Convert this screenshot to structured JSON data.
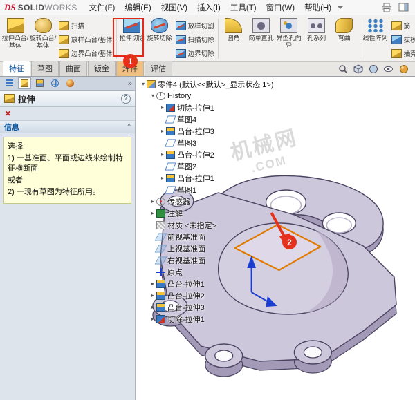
{
  "menubar": {
    "logo": {
      "ds": "DS",
      "text_bold": "SOLID",
      "text_light": "WORKS"
    },
    "menus": [
      {
        "label": "文件(F)"
      },
      {
        "label": "编辑(E)"
      },
      {
        "label": "视图(V)"
      },
      {
        "label": "插入(I)"
      },
      {
        "label": "工具(T)"
      },
      {
        "label": "窗口(W)"
      },
      {
        "label": "帮助(H)"
      }
    ],
    "right_icons": [
      "printer-icon",
      "toggle-panel-icon"
    ]
  },
  "ribbon": {
    "big": [
      {
        "label": "拉伸凸台/基体",
        "icon": "extrude-boss"
      },
      {
        "label": "旋转凸台/基体",
        "icon": "revolve-boss"
      },
      {
        "label": "拉伸切除",
        "icon": "extrude-cut"
      },
      {
        "label": "旋转切除",
        "icon": "revolve-cut"
      },
      {
        "label": "圆角",
        "icon": "fillet"
      },
      {
        "label": "简单直孔",
        "icon": "simple-hole"
      },
      {
        "label": "异型孔向导",
        "icon": "hole-wizard"
      },
      {
        "label": "孔系列",
        "icon": "hole-series"
      },
      {
        "label": "弯曲",
        "icon": "flex"
      },
      {
        "label": "线性阵列",
        "icon": "linear-pattern"
      }
    ],
    "stack1": [
      {
        "label": "扫描",
        "icon": "sweep"
      },
      {
        "label": "放样凸台/基体",
        "icon": "loft"
      },
      {
        "label": "边界凸台/基体",
        "icon": "boundary"
      }
    ],
    "stack2": [
      {
        "label": "放样切割",
        "icon": "loft-cut"
      },
      {
        "label": "扫描切除",
        "icon": "sweep-cut"
      },
      {
        "label": "边界切除",
        "icon": "boundary-cut"
      }
    ],
    "stack3": [
      {
        "label": "筋",
        "icon": "rib"
      },
      {
        "label": "拔模",
        "icon": "draft"
      },
      {
        "label": "抽壳",
        "icon": "shell"
      }
    ],
    "annotation_badge": "1"
  },
  "tabs": {
    "items": [
      {
        "label": "特征",
        "state": "active"
      },
      {
        "label": "草图",
        "state": "normal"
      },
      {
        "label": "曲面",
        "state": "normal"
      },
      {
        "label": "钣金",
        "state": "normal"
      },
      {
        "label": "焊件",
        "state": "highlight"
      },
      {
        "label": "评估",
        "state": "normal"
      }
    ]
  },
  "headsup_icons": [
    "zoom-fit-icon",
    "view-orientation-icon",
    "display-style-icon",
    "hide-show-icon",
    "appearance-icon"
  ],
  "panel": {
    "tab_icons": [
      "featuremanager-tab",
      "propertymanager-tab",
      "configurationmanager-tab",
      "dimxpert-tab",
      "displaymanager-tab"
    ],
    "flyout_glyph": "»",
    "title": "拉伸",
    "help_glyph": "?",
    "close_glyph": "×",
    "info": {
      "header": "信息",
      "collapse_glyph": "^"
    },
    "message_lines": [
      "选择:",
      "1) 一基准面、平面或边线来绘制特征横断面",
      "或者",
      "2) 一现有草图为特征所用。"
    ]
  },
  "tree": {
    "items": [
      {
        "label": "零件4 (默认<<默认>_显示状态 1>)",
        "lv": "lv0",
        "arrow": "▾",
        "icon": "part"
      },
      {
        "label": "History",
        "lv": "lv1",
        "arrow": "▾",
        "icon": "hist"
      },
      {
        "label": "切除-拉伸1",
        "lv": "lv2",
        "arrow": "▸",
        "icon": "cut"
      },
      {
        "label": "草图4",
        "lv": "lv2",
        "arrow": "",
        "icon": "sketch"
      },
      {
        "label": "凸台-拉伸3",
        "lv": "lv2",
        "arrow": "▸",
        "icon": "boss"
      },
      {
        "label": "草图3",
        "lv": "lv2",
        "arrow": "",
        "icon": "sketch"
      },
      {
        "label": "凸台-拉伸2",
        "lv": "lv2",
        "arrow": "▸",
        "icon": "boss"
      },
      {
        "label": "草图2",
        "lv": "lv2",
        "arrow": "",
        "icon": "sketch"
      },
      {
        "label": "凸台-拉伸1",
        "lv": "lv2",
        "arrow": "▸",
        "icon": "boss"
      },
      {
        "label": "草图1",
        "lv": "lv2",
        "arrow": "",
        "icon": "sketch"
      },
      {
        "label": "传感器",
        "lv": "lv1",
        "arrow": "▸",
        "icon": "sensor"
      },
      {
        "label": "注解",
        "lv": "lv1",
        "arrow": "▸",
        "icon": "anno"
      },
      {
        "label": "材质 <未指定>",
        "lv": "lv1",
        "arrow": "",
        "icon": "material"
      },
      {
        "label": "前视基准面",
        "lv": "lv1",
        "arrow": "",
        "icon": "plane"
      },
      {
        "label": "上视基准面",
        "lv": "lv1",
        "arrow": "",
        "icon": "plane"
      },
      {
        "label": "右视基准面",
        "lv": "lv1",
        "arrow": "",
        "icon": "plane"
      },
      {
        "label": "原点",
        "lv": "lv1",
        "arrow": "",
        "icon": "origin"
      },
      {
        "label": "凸台-拉伸1",
        "lv": "lv1",
        "arrow": "▸",
        "icon": "boss"
      },
      {
        "label": "凸台-拉伸2",
        "lv": "lv1",
        "arrow": "▸",
        "icon": "boss"
      },
      {
        "label": "凸台-拉伸3",
        "lv": "lv1",
        "arrow": "▸",
        "icon": "boss"
      },
      {
        "label": "切除-拉伸1",
        "lv": "lv1",
        "arrow": "▸",
        "icon": "cut"
      }
    ]
  },
  "canvas": {
    "badge": "2",
    "watermark_line1": "机械网",
    "watermark_line2": ".COM",
    "colors": {
      "part_face": "#cdc7dc",
      "part_shadow": "#a39ab8",
      "part_edge": "#4a4460",
      "sketch_edge": "#e07b00",
      "annotation_red": "#e5301c",
      "origin_blue": "#1a3fd0"
    }
  }
}
